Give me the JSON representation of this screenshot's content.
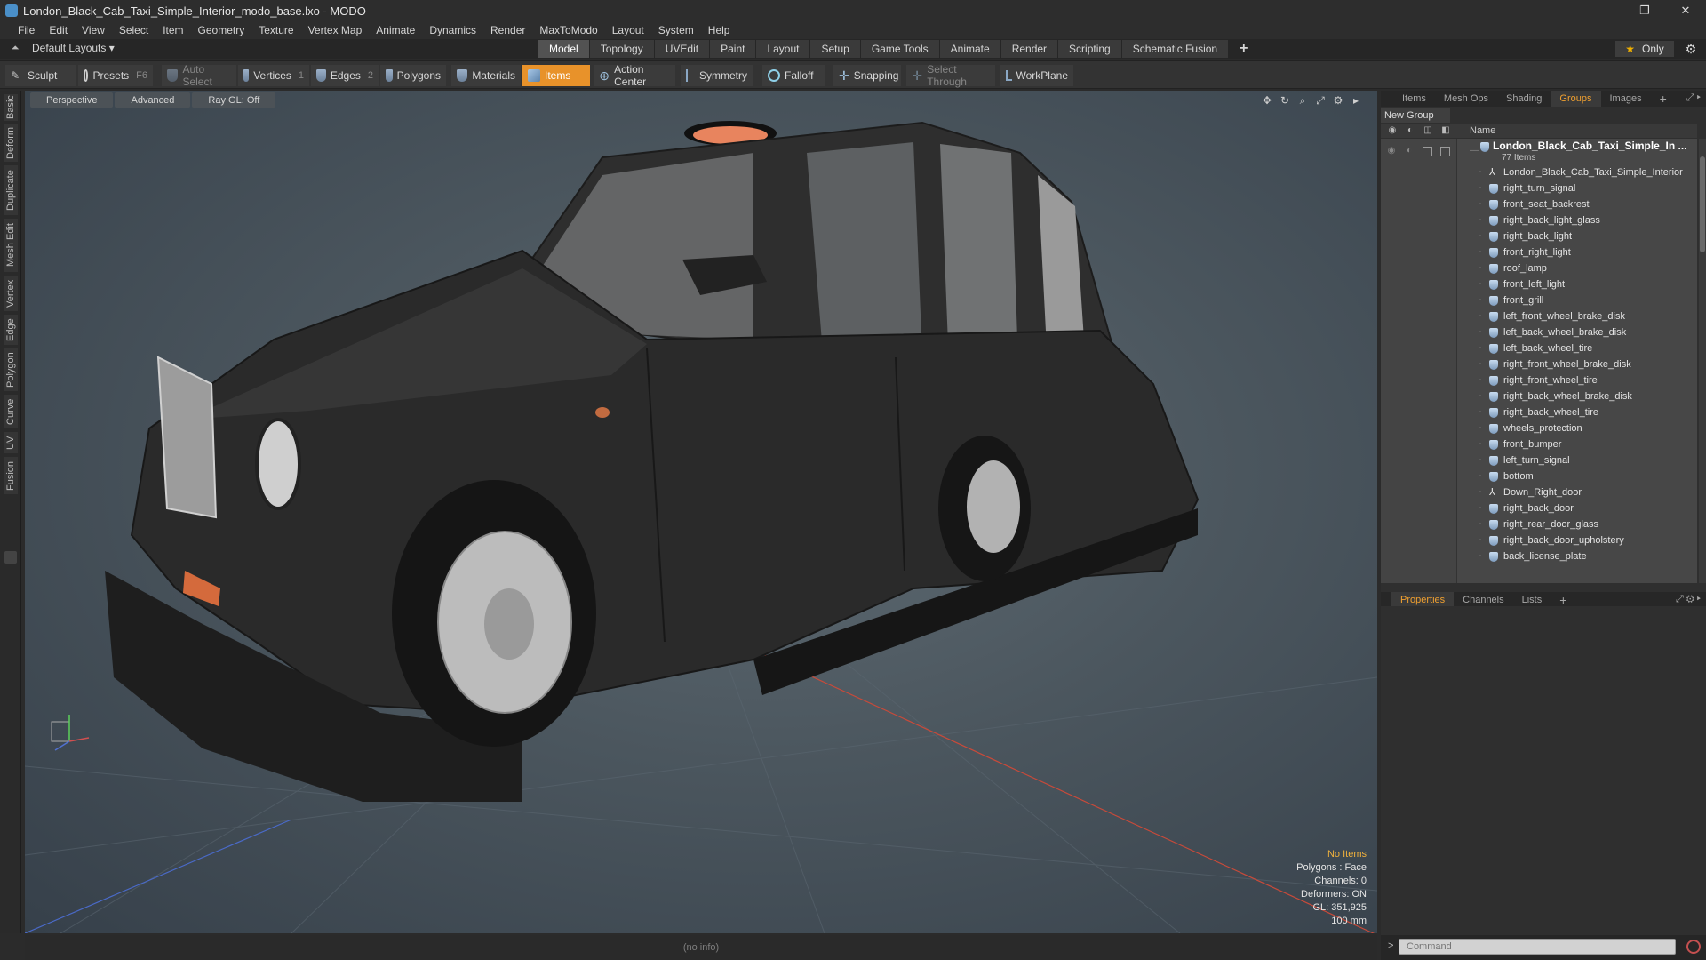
{
  "window": {
    "title": "London_Black_Cab_Taxi_Simple_Interior_modo_base.lxo - MODO",
    "controls": [
      "—",
      "❐",
      "✕"
    ]
  },
  "menu": [
    "File",
    "Edit",
    "View",
    "Select",
    "Item",
    "Geometry",
    "Texture",
    "Vertex Map",
    "Animate",
    "Dynamics",
    "Render",
    "MaxToModo",
    "Layout",
    "System",
    "Help"
  ],
  "layout_selector": "Default Layouts ▾",
  "layout_tabs": [
    {
      "label": "Model",
      "active": true
    },
    {
      "label": "Topology"
    },
    {
      "label": "UVEdit"
    },
    {
      "label": "Paint"
    },
    {
      "label": "Layout"
    },
    {
      "label": "Setup"
    },
    {
      "label": "Game Tools"
    },
    {
      "label": "Animate"
    },
    {
      "label": "Render"
    },
    {
      "label": "Scripting"
    },
    {
      "label": "Schematic Fusion"
    },
    {
      "label": "+"
    }
  ],
  "only_button": "Only",
  "toolbar": {
    "sculpt": "Sculpt",
    "presets": "Presets",
    "presets_key": "F6",
    "auto_select": "Auto Select",
    "vertices": "Vertices",
    "vertices_key": "1",
    "edges": "Edges",
    "edges_key": "2",
    "polygons": "Polygons",
    "materials": "Materials",
    "items": "Items",
    "action_center": "Action Center",
    "symmetry": "Symmetry",
    "falloff": "Falloff",
    "snapping": "Snapping",
    "select_through": "Select Through",
    "workplane": "WorkPlane"
  },
  "left_tabs": [
    "Basic",
    "Deform",
    "Duplicate",
    "Mesh Edit",
    "Vertex",
    "Edge",
    "Polygon",
    "Curve",
    "UV",
    "Fusion"
  ],
  "viewport": {
    "perspective": "Perspective",
    "advanced": "Advanced",
    "raygl": "Ray GL: Off",
    "info": {
      "no_items": "No Items",
      "polygons": "Polygons : Face",
      "channels": "Channels: 0",
      "deformers": "Deformers: ON",
      "gl": "GL: 351,925",
      "scale": "100 mm"
    }
  },
  "status_info": "(no info)",
  "right_panel": {
    "top_tabs": [
      "Items",
      "Mesh Ops",
      "Shading",
      "Groups",
      "Images",
      "+"
    ],
    "active_top_tab": "Groups",
    "new_group": "New Group",
    "column_name": "Name",
    "root": {
      "name": "London_Black_Cab_Taxi_Simple_In ...",
      "count": "77 Items"
    },
    "items": [
      {
        "name": "London_Black_Cab_Taxi_Simple_Interior",
        "icon": "locator-icon"
      },
      {
        "name": "right_turn_signal",
        "icon": "mesh-icon"
      },
      {
        "name": "front_seat_backrest",
        "icon": "mesh-icon"
      },
      {
        "name": "right_back_light_glass",
        "icon": "mesh-icon"
      },
      {
        "name": "right_back_light",
        "icon": "mesh-icon"
      },
      {
        "name": "front_right_light",
        "icon": "mesh-icon"
      },
      {
        "name": "roof_lamp",
        "icon": "mesh-icon"
      },
      {
        "name": "front_left_light",
        "icon": "mesh-icon"
      },
      {
        "name": "front_grill",
        "icon": "mesh-icon"
      },
      {
        "name": "left_front_wheel_brake_disk",
        "icon": "mesh-icon"
      },
      {
        "name": "left_back_wheel_brake_disk",
        "icon": "mesh-icon"
      },
      {
        "name": "left_back_wheel_tire",
        "icon": "mesh-icon"
      },
      {
        "name": "right_front_wheel_brake_disk",
        "icon": "mesh-icon"
      },
      {
        "name": "right_front_wheel_tire",
        "icon": "mesh-icon"
      },
      {
        "name": "right_back_wheel_brake_disk",
        "icon": "mesh-icon"
      },
      {
        "name": "right_back_wheel_tire",
        "icon": "mesh-icon"
      },
      {
        "name": "wheels_protection",
        "icon": "mesh-icon"
      },
      {
        "name": "front_bumper",
        "icon": "mesh-icon"
      },
      {
        "name": "left_turn_signal",
        "icon": "mesh-icon"
      },
      {
        "name": "bottom",
        "icon": "mesh-icon"
      },
      {
        "name": "Down_Right_door",
        "icon": "locator-icon"
      },
      {
        "name": "right_back_door",
        "icon": "mesh-icon"
      },
      {
        "name": "right_rear_door_glass",
        "icon": "mesh-icon"
      },
      {
        "name": "right_back_door_upholstery",
        "icon": "mesh-icon"
      },
      {
        "name": "back_license_plate",
        "icon": "mesh-icon"
      }
    ],
    "bottom_tabs": [
      "Properties",
      "Channels",
      "Lists",
      "+"
    ],
    "active_bottom_tab": "Properties",
    "command_placeholder": "Command"
  },
  "colors": {
    "accent": "#e8922a",
    "active_tab_text": "#f0a030",
    "viewport_bg": "#4b565e",
    "taxi_body": "#2c2c2c"
  }
}
